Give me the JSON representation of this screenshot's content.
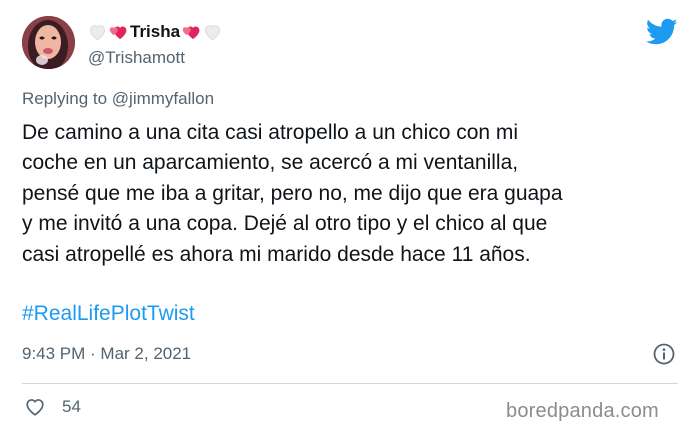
{
  "author": {
    "display_name": "Trisha",
    "handle": "@Trishamott",
    "avatar": "profile-photo",
    "name_decorations": [
      "white-heart-icon",
      "sparkling-heart-icon",
      "sparkling-heart-icon",
      "white-heart-icon"
    ]
  },
  "brand": {
    "logo": "twitter-bird-icon",
    "color": "#1d9bf0"
  },
  "reply": {
    "prefix": "Replying to",
    "mention": "@jimmyfallon"
  },
  "tweet": {
    "text": "De camino a una cita casi atropello a un chico con mi\ncoche en un aparcamiento, se acercó a mi ventanilla,\npensé que me iba a gritar, pero no, me dijo que era guapa\ny me invitó a una copa. Dejé al otro tipo y el chico al que\ncasi atropellé es ahora mi marido desde hace 11 años.",
    "hashtag": "#RealLifePlotTwist",
    "timestamp": "9:43 PM · Mar 2, 2021"
  },
  "engagement": {
    "likes": "54",
    "like_icon": "heart-outline-icon",
    "info_icon": "info-icon"
  },
  "watermark": "boredpanda.com",
  "colors": {
    "text": "#0f1419",
    "secondary": "#536471",
    "link": "#1d9bf0",
    "heart_pink": "#e0245e"
  }
}
